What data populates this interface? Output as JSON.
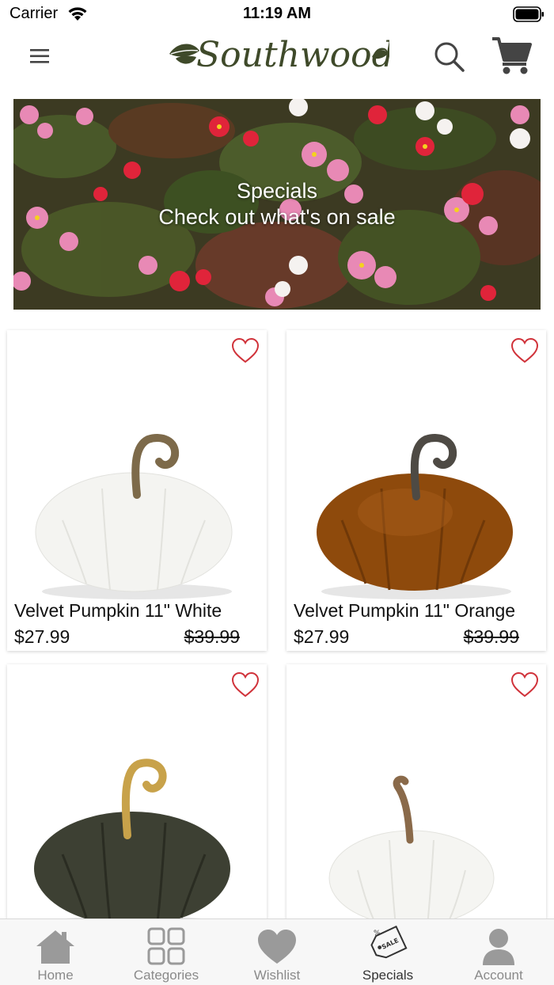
{
  "status_bar": {
    "carrier": "Carrier",
    "time": "11:19 AM"
  },
  "header": {
    "logo_text": "Southwood"
  },
  "banner": {
    "title": "Specials",
    "subtitle": "Check out what's on sale"
  },
  "products": [
    {
      "name": "Velvet Pumpkin 11\" White",
      "price": "$27.99",
      "old_price": "$39.99",
      "color": "#f4f4f1"
    },
    {
      "name": "Velvet Pumpkin 11\" Orange",
      "price": "$27.99",
      "old_price": "$39.99",
      "color": "#8e4a0c"
    },
    {
      "name": "",
      "price": "",
      "old_price": "",
      "color": "#3d4033"
    },
    {
      "name": "",
      "price": "",
      "old_price": "",
      "color": "#f5f5f2"
    }
  ],
  "tabs": [
    {
      "label": "Home",
      "icon": "home-icon"
    },
    {
      "label": "Categories",
      "icon": "grid-icon"
    },
    {
      "label": "Wishlist",
      "icon": "heart-icon"
    },
    {
      "label": "Specials",
      "icon": "sale-tag-icon",
      "active": true
    },
    {
      "label": "Account",
      "icon": "person-icon"
    }
  ],
  "colors": {
    "heart_outline": "#d0323a",
    "tab_icon": "#9a9a9a",
    "logo": "#3f4a2a"
  }
}
